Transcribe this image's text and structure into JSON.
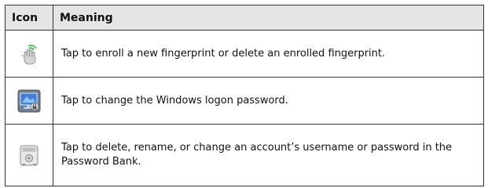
{
  "table": {
    "headers": {
      "icon": "Icon",
      "meaning": "Meaning"
    },
    "rows": [
      {
        "icon": "fingerprint-hand-icon",
        "meaning": "Tap to enroll a new fingerprint or delete an enrolled fingerprint."
      },
      {
        "icon": "windows-logon-password-icon",
        "meaning": "Tap to change the Windows logon password."
      },
      {
        "icon": "password-bank-safe-icon",
        "meaning": "Tap to delete, rename, or change an account’s username or password in the Password Bank."
      }
    ]
  }
}
